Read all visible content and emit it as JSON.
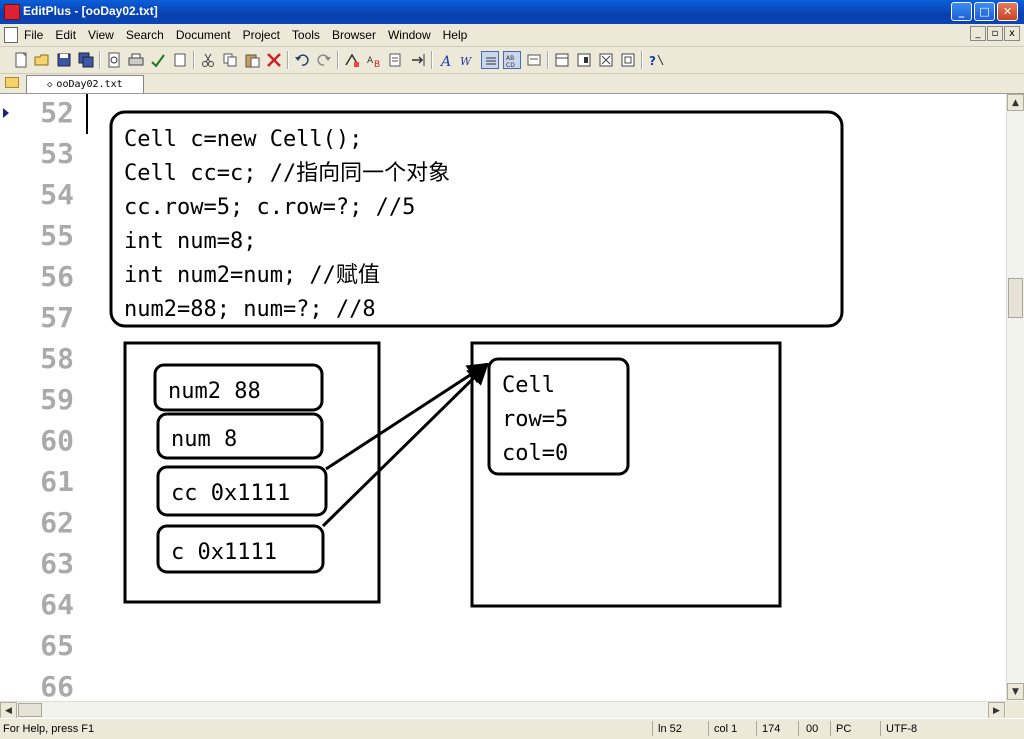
{
  "window": {
    "title": "EditPlus - [ooDay02.txt]",
    "buttons": {
      "minimize": "_",
      "maximize": "□",
      "close": "✕"
    }
  },
  "menu": {
    "items": [
      "File",
      "Edit",
      "View",
      "Search",
      "Document",
      "Project",
      "Tools",
      "Browser",
      "Window",
      "Help"
    ],
    "mdi_buttons": {
      "minimize": "_",
      "restore": "▫",
      "close": "x"
    }
  },
  "tab": {
    "label": "ooDay02.txt",
    "marker": "◇"
  },
  "editor": {
    "line_numbers": [
      "52",
      "53",
      "54",
      "55",
      "56",
      "57",
      "58",
      "59",
      "60",
      "61",
      "62",
      "63",
      "64",
      "65",
      "66"
    ],
    "code_lines": [
      "Cell c=new Cell();",
      "Cell cc=c; //指向同一个对象",
      "cc.row=5;  c.row=?; //5",
      "int num=8;",
      "int num2=num; //赋值",
      "num2=88;  num=?; //8"
    ],
    "stack_boxes": [
      "num2 88",
      "num 8",
      "cc 0x1111",
      "c 0x1111"
    ],
    "heap_lines": [
      "Cell",
      "row=5",
      "col=0"
    ]
  },
  "status": {
    "help": "For Help, press F1",
    "line": "ln 52",
    "col": "col 1",
    "pos": "174",
    "num": "00",
    "mode": "PC",
    "encoding": "UTF-8"
  },
  "colors": {
    "titlebar": "#0a3fb0",
    "chrome": "#ece9d8",
    "line_number": "#aaaaaa"
  }
}
